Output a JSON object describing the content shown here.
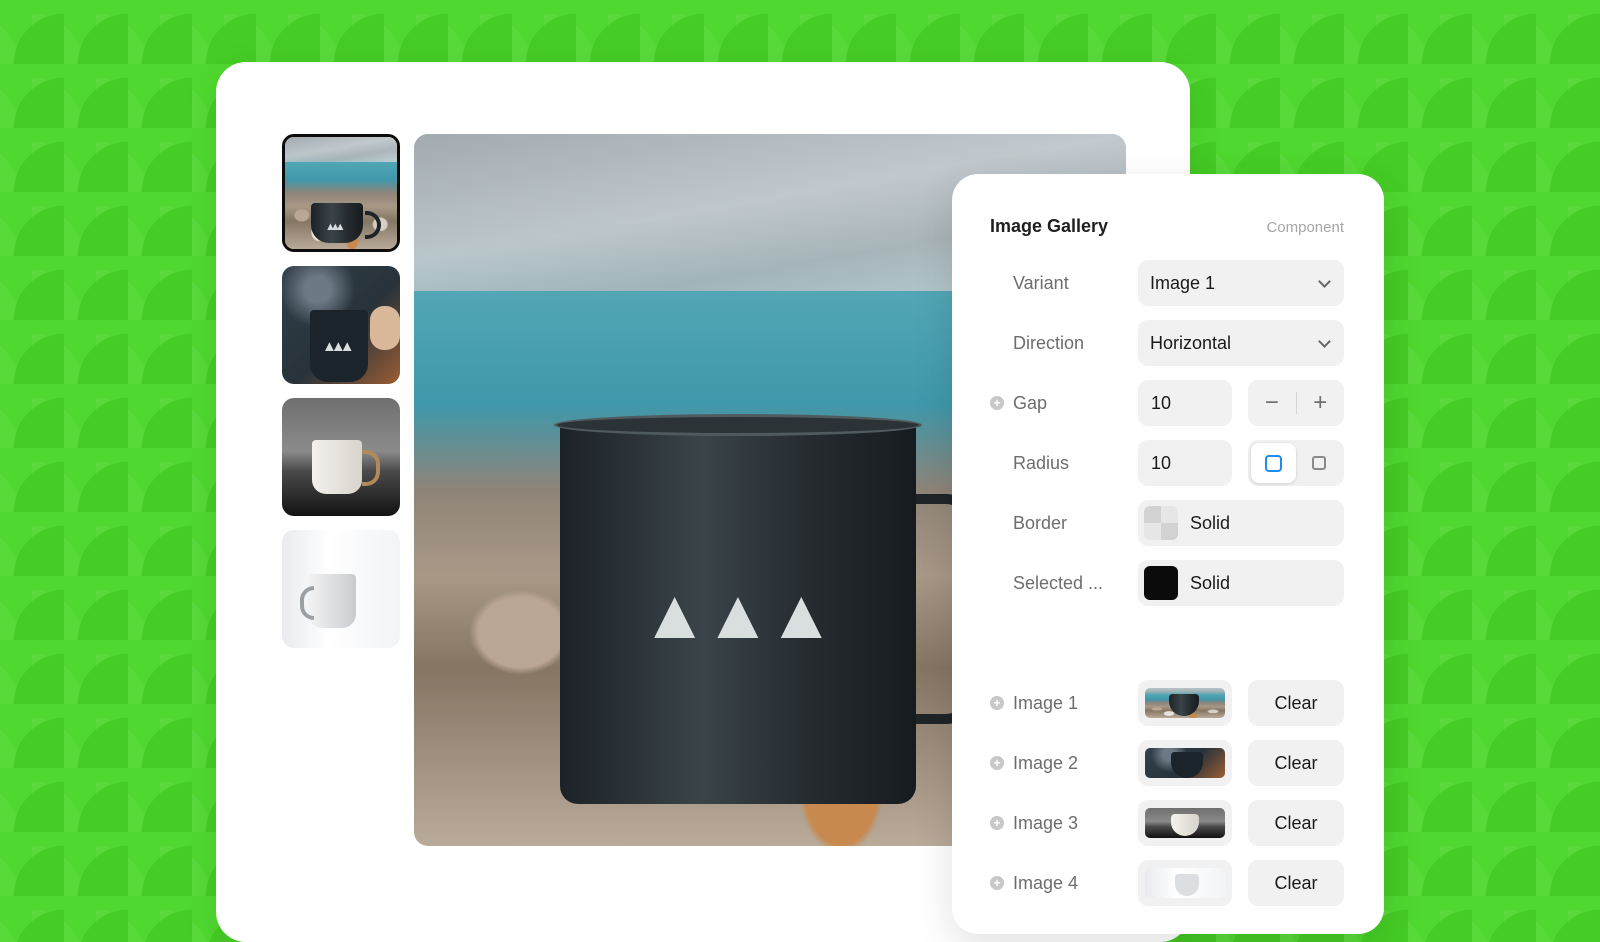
{
  "gallery": {
    "thumbnails": [
      {
        "name": "Image 1",
        "selected": true
      },
      {
        "name": "Image 2",
        "selected": false
      },
      {
        "name": "Image 3",
        "selected": false
      },
      {
        "name": "Image 4",
        "selected": false
      }
    ],
    "main_image": "Image 1"
  },
  "panel": {
    "title": "Image Gallery",
    "subtitle": "Component",
    "variant": {
      "label": "Variant",
      "value": "Image 1"
    },
    "direction": {
      "label": "Direction",
      "value": "Horizontal"
    },
    "gap": {
      "label": "Gap",
      "value": "10",
      "decrement": "−",
      "increment": "+"
    },
    "radius": {
      "label": "Radius",
      "value": "10"
    },
    "border": {
      "label": "Border",
      "value": "Solid",
      "swatch": "checker"
    },
    "selected": {
      "label": "Selected ...",
      "value": "Solid",
      "swatch_color": "#0b0b0b"
    },
    "images": [
      {
        "label": "Image 1",
        "clear": "Clear"
      },
      {
        "label": "Image 2",
        "clear": "Clear"
      },
      {
        "label": "Image 3",
        "clear": "Clear"
      },
      {
        "label": "Image 4",
        "clear": "Clear"
      }
    ]
  },
  "colors": {
    "background": "#4fd82f",
    "accent": "#1e8cf0",
    "field": "#f1f1f1"
  }
}
